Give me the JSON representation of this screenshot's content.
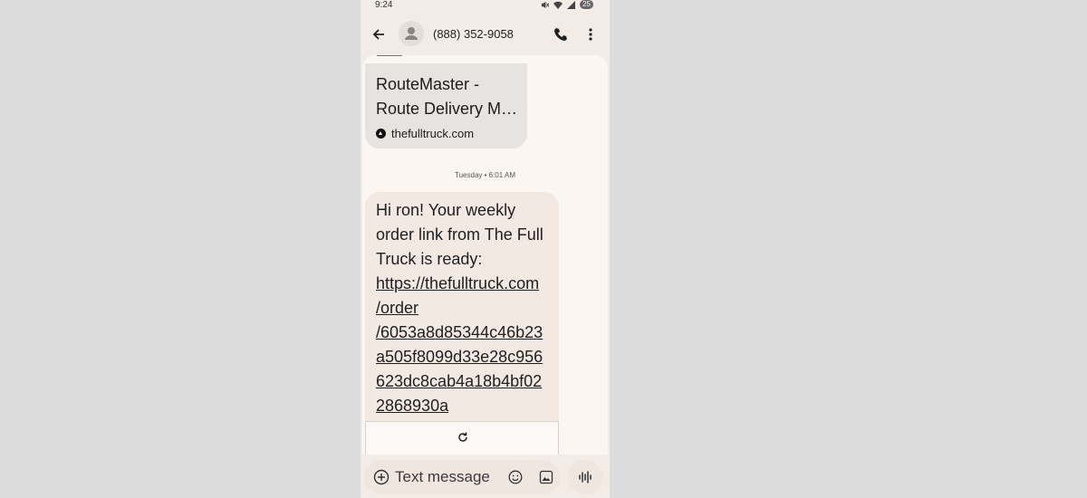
{
  "status_bar": {
    "time": "9:24",
    "battery": "25",
    "icons": [
      "mute-icon",
      "wifi-icon",
      "signal-icon",
      "battery-icon"
    ]
  },
  "app_bar": {
    "contact": "(888) 352-9058",
    "icons": [
      "back-arrow-icon",
      "avatar-icon",
      "phone-call-icon",
      "more-vert-icon"
    ]
  },
  "link_preview": {
    "title_line1": "RouteMaster -",
    "title_line2": "Route Delivery Management",
    "domain": "thefulltruck.com"
  },
  "timestamp": "Tuesday • 6:01 AM",
  "message": {
    "text": "Hi ron! Your weekly order link from The Full Truck is ready:",
    "link_line1": "https://thefulltruck.com",
    "link_line2": "/order",
    "link_line3": "/6053a8d85344c46b23",
    "link_line4": "a505f8099d33e28c956",
    "link_line5": "623dc8cab4a18b4bf02",
    "link_line6": "2868930a"
  },
  "composer": {
    "placeholder": "Text message",
    "icons": [
      "add-circle-icon",
      "emoji-icon",
      "image-icon",
      "voice-waveform-icon"
    ]
  },
  "colors": {
    "page_bg": "#dcdcdc",
    "app_bg": "#f3ebe5",
    "thread_bg": "#fcf6f2",
    "bubble": "#f2e9e3",
    "preview_card": "#e6e3e0"
  }
}
